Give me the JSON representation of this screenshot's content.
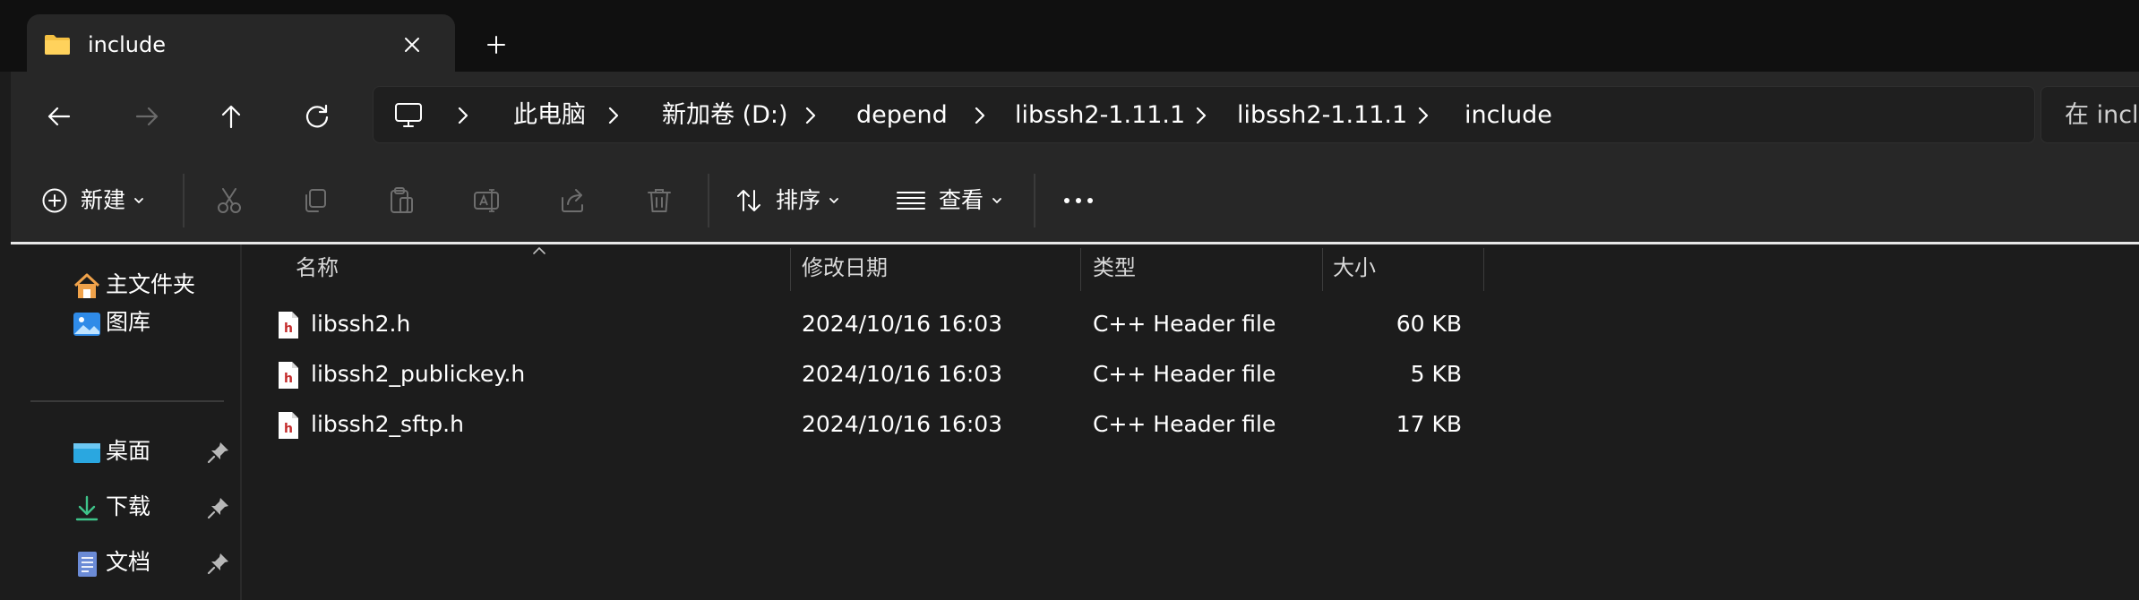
{
  "tab": {
    "title": "include"
  },
  "breadcrumb": {
    "items": [
      "此电脑",
      "新加卷 (D:)",
      "depend",
      "libssh2-1.11.1",
      "libssh2-1.11.1",
      "include"
    ]
  },
  "search": {
    "placeholder": "在 incl"
  },
  "toolbar": {
    "new_label": "新建",
    "sort_label": "排序",
    "view_label": "查看"
  },
  "nav": {
    "items": [
      {
        "label": "主文件夹",
        "icon": "home-icon"
      },
      {
        "label": "图库",
        "icon": "gallery-icon"
      },
      {
        "label": "桌面",
        "icon": "desktop-icon",
        "pinned": true
      },
      {
        "label": "下载",
        "icon": "download-icon",
        "pinned": true
      },
      {
        "label": "文档",
        "icon": "documents-icon",
        "pinned": true
      }
    ]
  },
  "columns": {
    "name": "名称",
    "modified": "修改日期",
    "type": "类型",
    "size": "大小"
  },
  "files": [
    {
      "name": "libssh2.h",
      "modified": "2024/10/16 16:03",
      "type": "C++ Header file",
      "size": "60 KB"
    },
    {
      "name": "libssh2_publickey.h",
      "modified": "2024/10/16 16:03",
      "type": "C++ Header file",
      "size": "5 KB"
    },
    {
      "name": "libssh2_sftp.h",
      "modified": "2024/10/16 16:03",
      "type": "C++ Header file",
      "size": "17 KB"
    }
  ],
  "colors": {
    "folder": "#f4c042",
    "accent_line": "#e8e8e8",
    "header_file_icon": "#c42b2b"
  }
}
